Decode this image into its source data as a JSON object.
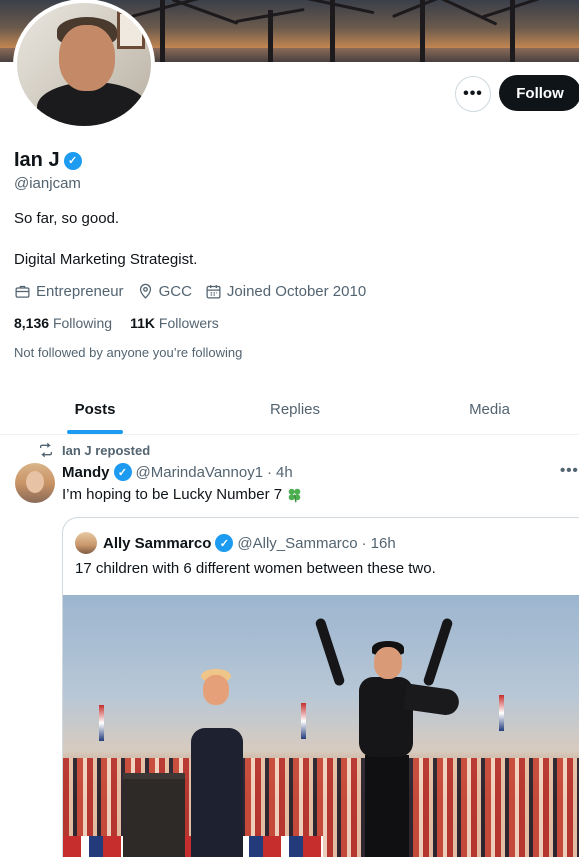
{
  "profile": {
    "name": "Ian J",
    "handle": "@ianjcam",
    "bio_line1": "So far, so good.",
    "bio_line2": "Digital Marketing Strategist.",
    "category": "Entrepreneur",
    "location": "GCC",
    "joined": "Joined October 2010",
    "following_count": "8,136",
    "following_label": "Following",
    "followers_count": "11K",
    "followers_label": "Followers",
    "not_followed_note": "Not followed by anyone you’re following"
  },
  "actions": {
    "more_label": "•••",
    "follow_label": "Follow"
  },
  "tabs": [
    {
      "label": "Posts",
      "active": true
    },
    {
      "label": "Replies",
      "active": false
    },
    {
      "label": "Media",
      "active": false
    }
  ],
  "post": {
    "repost_text": "Ian J reposted",
    "author_name": "Mandy",
    "author_handle": "@MarindaVannoy1",
    "time": "4h",
    "separator": "·",
    "text": "I’m hoping to be Lucky Number 7",
    "more_label": "•••",
    "quote": {
      "author_name": "Ally Sammarco",
      "author_handle": "@Ally_Sammarco",
      "time": "16h",
      "separator": "·",
      "text": "17 children with 6 different women between these two."
    }
  },
  "colors": {
    "accent": "#1d9bf0",
    "text_primary": "#0f1419",
    "text_secondary": "#536471",
    "border": "#cfd9de",
    "follow_bg": "#0f1419"
  },
  "icons": {
    "verified": "verified-badge-icon",
    "category": "briefcase-icon",
    "location": "location-pin-icon",
    "joined": "calendar-icon",
    "repost": "repost-icon",
    "clover": "four-leaf-clover-icon"
  }
}
